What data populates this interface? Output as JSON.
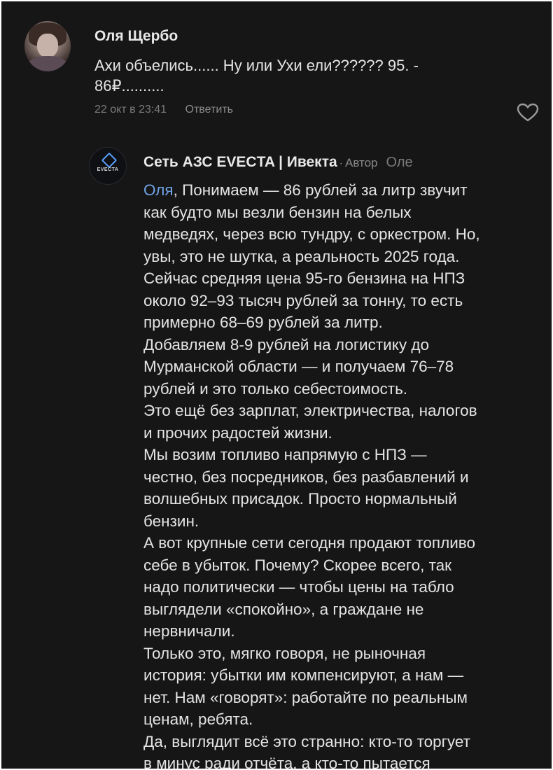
{
  "top_comment": {
    "author": "Оля Щербо",
    "text_lines": [
      "Ахи объелись...... Ну или Ухи ели?????? 95. -",
      "86₽.........."
    ],
    "timestamp": "22 окт в 23:41",
    "reply_label": "Ответить",
    "like_icon": "heart-outline-icon"
  },
  "reply": {
    "author": "Сеть АЗС EVECTA | Ивекта",
    "separator": "·",
    "author_badge": "Автор",
    "reply_to": "Оле",
    "avatar_logo_text": "EVECTA",
    "mention": "Оля",
    "body_lines": [
      ", Понимаем — 86 рублей за литр звучит",
      "как будто мы везли бензин на белых",
      "медведях, через всю тундру, с оркестром. Но,",
      "увы, это не шутка, а реальность 2025 года.",
      "Сейчас средняя цена 95-го бензина на НПЗ",
      "около 92–93 тысяч рублей за тонну, то есть",
      "примерно 68–69 рублей за литр.",
      "Добавляем 8-9 рублей на логистику до",
      "Мурманской области — и получаем 76–78",
      "рублей и это только себестоимость.",
      "Это ещё без зарплат, электричества, налогов",
      "и прочих радостей жизни.",
      "Мы возим топливо напрямую с НПЗ —",
      "честно, без посредников, без разбавлений и",
      "волшебных присадок. Просто нормальный",
      "бензин.",
      "А вот крупные сети сегодня продают топливо",
      "себе в убыток. Почему? Скорее всего, так",
      "надо политически — чтобы цены на табло",
      "выглядели «спокойно», а граждане не",
      "нервничали.",
      "Только это, мягко говоря, не рыночная",
      "история: убытки им компенсируют, а нам —",
      "нет. Нам «говорят»: работайте по реальным",
      "ценам, ребята.",
      "Да, выглядит всё это странно: кто-то торгует",
      "в минус ради отчёта, а кто-то пытается"
    ]
  },
  "colors": {
    "background": "#161616",
    "mention": "#6fa3e6",
    "muted": "#7b7b7b"
  }
}
